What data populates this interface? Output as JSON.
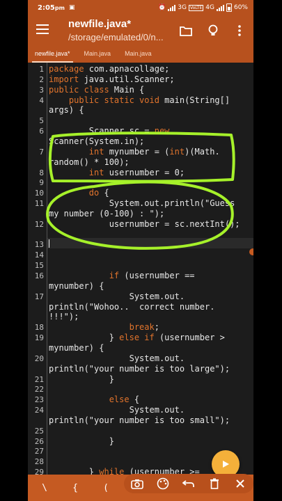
{
  "status": {
    "time": "2:05",
    "time_suffix": "pm",
    "net": "3G",
    "net2": "4G",
    "battery": "60%"
  },
  "app": {
    "title": "newfile.java*",
    "subtitle": "/storage/emulated/0/n...",
    "accent": "#b7511e",
    "keyword_color": "#e2742c",
    "annotation_color": "#a6f12a"
  },
  "icons": {
    "menu": "menu-icon",
    "folder": "folder-icon",
    "lightbulb": "lightbulb-icon",
    "more": "more-vert-icon",
    "run": "play-icon",
    "camera": "camera-icon",
    "palette": "palette-icon",
    "undo": "undo-icon",
    "delete": "trash-icon",
    "close": "close-icon"
  },
  "tabs": [
    {
      "label": "newfile.java*"
    },
    {
      "label": "Main.java"
    },
    {
      "label": "Main.java"
    }
  ],
  "editor": {
    "lines": [
      {
        "n": "1",
        "parts": [
          {
            "k": "package",
            "t": " com.apnacollage;"
          }
        ]
      },
      {
        "n": "2",
        "parts": [
          {
            "k": "import",
            "t": " java.util.Scanner;"
          }
        ]
      },
      {
        "n": "3",
        "parts": [
          {
            "k": "public class",
            "t": " Main {"
          }
        ]
      },
      {
        "n": "4",
        "parts": [
          {
            "t": "    "
          },
          {
            "k": "public static void",
            "t": " main(String[]"
          }
        ]
      },
      {
        "n": "",
        "parts": [
          {
            "t": "args) {"
          }
        ]
      },
      {
        "n": "5",
        "parts": []
      },
      {
        "n": "6",
        "parts": [
          {
            "t": "        Scanner sc = "
          },
          {
            "k": "new",
            "t": ""
          }
        ]
      },
      {
        "n": "",
        "parts": [
          {
            "t": "Scanner(System.in);"
          }
        ]
      },
      {
        "n": "7",
        "parts": [
          {
            "t": "        "
          },
          {
            "k": "int",
            "t": " mynumber = ("
          },
          {
            "k": "int",
            "t": ")(Math."
          }
        ]
      },
      {
        "n": "",
        "parts": [
          {
            "t": "random() * 100);"
          }
        ]
      },
      {
        "n": "8",
        "parts": [
          {
            "t": "        "
          },
          {
            "k": "int",
            "t": " usernumber = 0;"
          }
        ]
      },
      {
        "n": "9",
        "parts": []
      },
      {
        "n": "10",
        "parts": [
          {
            "t": "        "
          },
          {
            "k": "do",
            "t": " {"
          }
        ]
      },
      {
        "n": "11",
        "parts": [
          {
            "t": "            System.out.println(\"Guess"
          }
        ]
      },
      {
        "n": "",
        "parts": [
          {
            "t": "my number (0-100) : \");"
          }
        ]
      },
      {
        "n": "12",
        "parts": [
          {
            "t": "            usernumber = sc.nextInt();"
          }
        ]
      },
      {
        "n": "",
        "parts": []
      },
      {
        "n": "13",
        "parts": []
      },
      {
        "n": "14",
        "parts": []
      },
      {
        "n": "15",
        "parts": []
      },
      {
        "n": "16",
        "parts": [
          {
            "t": "            "
          },
          {
            "k": "if",
            "t": " (usernumber =="
          }
        ]
      },
      {
        "n": "",
        "parts": [
          {
            "t": "mynumber) {"
          }
        ]
      },
      {
        "n": "17",
        "parts": [
          {
            "t": "                System.out."
          }
        ]
      },
      {
        "n": "",
        "parts": [
          {
            "t": "println(\"Wohoo..  correct number."
          }
        ]
      },
      {
        "n": "",
        "parts": [
          {
            "t": "!!!\");"
          }
        ]
      },
      {
        "n": "18",
        "parts": [
          {
            "t": "                "
          },
          {
            "k": "break",
            "t": ";"
          }
        ]
      },
      {
        "n": "19",
        "parts": [
          {
            "t": "            } "
          },
          {
            "k": "else if",
            "t": " (usernumber >"
          }
        ]
      },
      {
        "n": "",
        "parts": [
          {
            "t": "mynumber) {"
          }
        ]
      },
      {
        "n": "20",
        "parts": [
          {
            "t": "                System.out."
          }
        ]
      },
      {
        "n": "",
        "parts": [
          {
            "t": "println(\"your number is too large\");"
          }
        ]
      },
      {
        "n": "21",
        "parts": [
          {
            "t": "            }"
          }
        ]
      },
      {
        "n": "22",
        "parts": []
      },
      {
        "n": "23",
        "parts": [
          {
            "t": "            "
          },
          {
            "k": "else",
            "t": " {"
          }
        ]
      },
      {
        "n": "24",
        "parts": [
          {
            "t": "                System.out."
          }
        ]
      },
      {
        "n": "",
        "parts": [
          {
            "t": "println(\"your number is too small\");"
          }
        ]
      },
      {
        "n": "25",
        "parts": []
      },
      {
        "n": "26",
        "parts": [
          {
            "t": "            }"
          }
        ]
      },
      {
        "n": "27",
        "parts": []
      },
      {
        "n": "28",
        "parts": []
      },
      {
        "n": "29",
        "parts": [
          {
            "t": "        } "
          },
          {
            "k": "while",
            "t": " (usernumber >="
          }
        ]
      }
    ]
  },
  "symbols": [
    "\\",
    "{",
    "("
  ]
}
